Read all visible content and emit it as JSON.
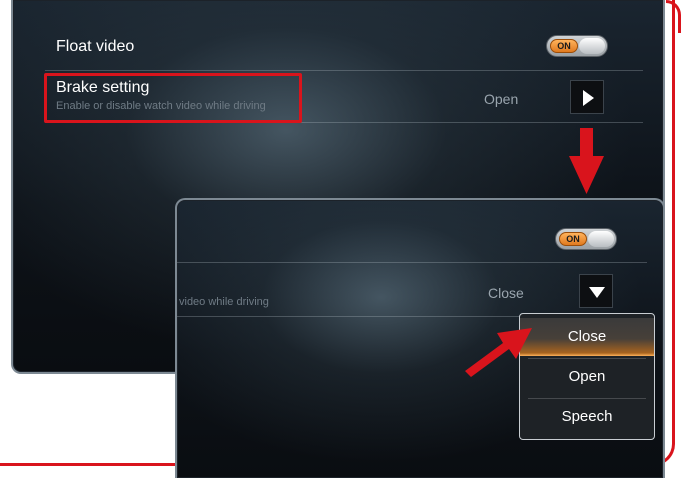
{
  "colors": {
    "annotation_red": "#d9141c",
    "toggle_on": "#e07a1f",
    "selected_glow": "#ffb25a"
  },
  "screen_before": {
    "float_video": {
      "label": "Float video",
      "toggle": "ON"
    },
    "brake_setting": {
      "label": "Brake setting",
      "description": "Enable or disable watch video while driving",
      "value": "Open",
      "expand_icon": "play-right-icon"
    }
  },
  "screen_after": {
    "float_video": {
      "toggle": "ON"
    },
    "brake_setting": {
      "description_fragment": "video while driving",
      "value": "Close",
      "expand_icon": "chevron-down-icon"
    },
    "dropdown": {
      "options": [
        "Close",
        "Open",
        "Speech"
      ],
      "selected": "Close"
    }
  },
  "annotations": [
    "highlight-box",
    "down-arrow",
    "pointer-arrow"
  ]
}
